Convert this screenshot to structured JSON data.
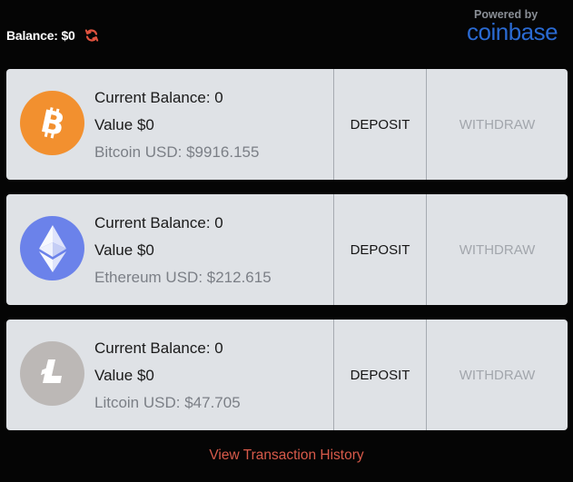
{
  "header": {
    "balance_label": "Balance: $0",
    "refresh_icon": "refresh-icon",
    "powered_by": "Powered by",
    "brand": "coinbase",
    "brand_color": "#2a6ad2"
  },
  "accounts": [
    {
      "current_balance": "Current Balance: 0",
      "value": "Value $0",
      "price": "Bitcoin USD: $9916.155",
      "icon": "bitcoin-icon",
      "icon_color": "#f2902f",
      "deposit_label": "DEPOSIT",
      "withdraw_label": "WITHDRAW"
    },
    {
      "current_balance": "Current Balance: 0",
      "value": "Value $0",
      "price": "Ethereum USD: $212.615",
      "icon": "ethereum-icon",
      "icon_color": "#6b82ea",
      "deposit_label": "DEPOSIT",
      "withdraw_label": "WITHDRAW"
    },
    {
      "current_balance": "Current Balance: 0",
      "value": "Value $0",
      "price": "Litcoin USD: $47.705",
      "icon": "litecoin-icon",
      "icon_color": "#bcb8b6",
      "deposit_label": "DEPOSIT",
      "withdraw_label": "WITHDRAW"
    }
  ],
  "footer": {
    "history_link": "View Transaction History",
    "link_color": "#d85a4a"
  }
}
